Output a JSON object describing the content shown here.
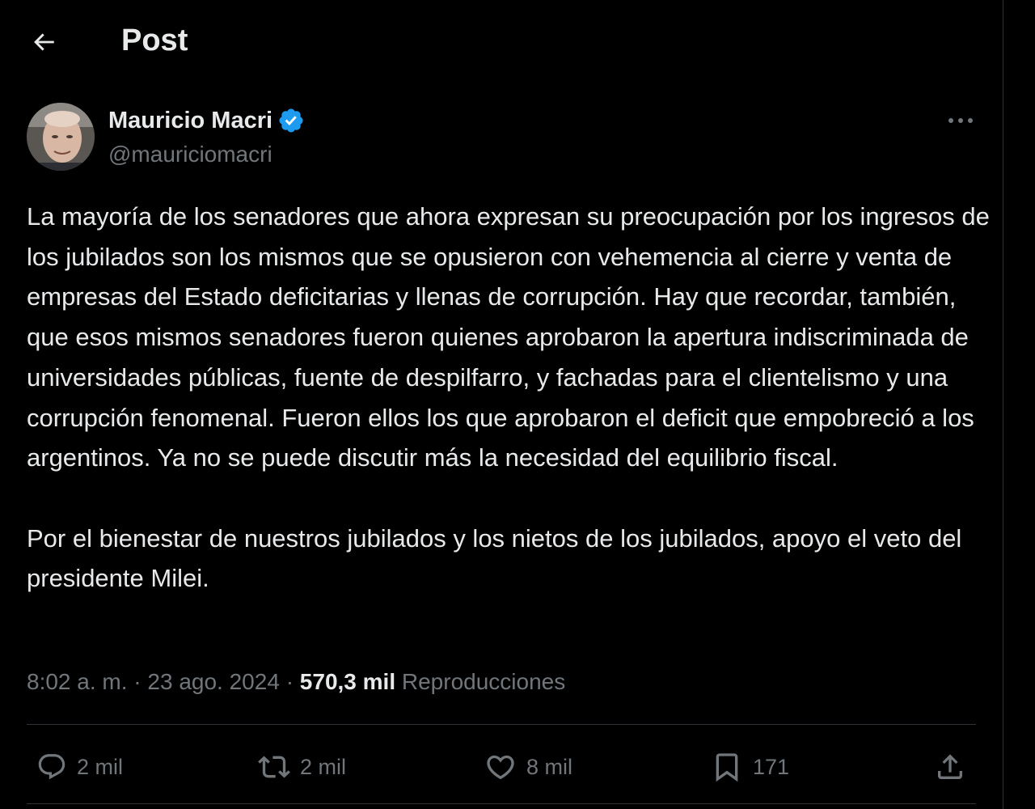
{
  "header": {
    "title": "Post",
    "back_icon": "arrow-left-icon"
  },
  "post": {
    "author": {
      "name": "Mauricio Macri",
      "handle": "@mauriciomacri",
      "verified": true,
      "verified_color": "#1d9bf0"
    },
    "paragraphs": [
      "La mayoría de los senadores que ahora expresan su preocupación por los ingresos de los jubilados son los mismos que se opusieron con vehemencia al cierre y venta de empresas del Estado deficitarias y llenas de corrupción. Hay que recordar, también, que esos mismos senadores fueron quienes aprobaron la apertura indiscriminada de universidades públicas, fuente de despilfarro, y fachadas para el clientelismo y una corrupción fenomenal. Fueron ellos los que aprobaron el deficit que empobreció a los argentinos. Ya no se puede discutir más la necesidad del equilibrio fiscal.",
      "Por el bienestar de nuestros jubilados y los nietos de los jubilados, apoyo el veto del presidente Milei."
    ],
    "time": "8:02 a. m.",
    "date": "23 ago. 2024",
    "separator": "·",
    "views_count": "570,3 mil",
    "views_label": "Reproducciones"
  },
  "actions": {
    "replies": "2 mil",
    "reposts": "2 mil",
    "likes": "8 mil",
    "bookmarks": "171"
  },
  "colors": {
    "background": "#000000",
    "text_primary": "#e7e9ea",
    "text_secondary": "#71767b",
    "divider": "#2f3336"
  }
}
